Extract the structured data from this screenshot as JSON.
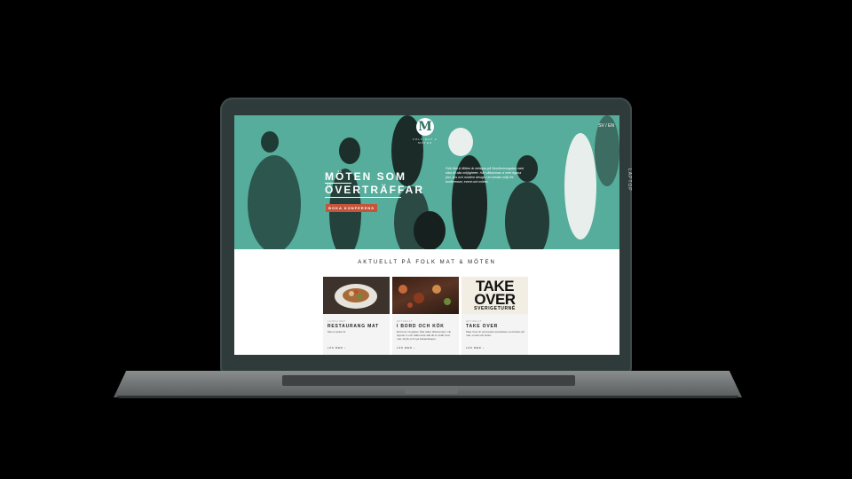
{
  "device": {
    "side_label": "LAPTOP"
  },
  "site": {
    "logo_letter": "M",
    "logo_text": "FOLK MAT & MÖTEN",
    "lang": "SV / EN",
    "hero": {
      "headline_1": "MÖTEN SOM",
      "headline_2": "ÖVERTRÄFFAR",
      "cta": "BOKA KONFERENS",
      "intro": "Folk Mat & Möten är belägna på Stockholmsgatan med nära till alla möjligheter. Här välkomnas vi med öppna ytor, ljus och modern design i en kreativ miljö för konferenser, event och möten."
    },
    "section_title": "AKTUELLT PÅ FOLK MAT & MÖTEN",
    "cards": [
      {
        "kicker": "LUNCH MAT",
        "title": "RESTAURANG MAT",
        "desc": "Menu vecka 14",
        "more": "LÄS MER ›"
      },
      {
        "kicker": "AKTUELLT",
        "title": "I BORD OCH KÖK",
        "desc": "Ett bord, 14 gäster, åtta rätter tillsammans. Nu öppnar vi och välkomnar alla till en kväll med mat, dryck och nya bekantskaper.",
        "more": "LÄS MER ›"
      },
      {
        "kicker": "AKTUELLT",
        "title": "TAKE OVER",
        "desc": "Take Over är ett kreativt samarbete med fokus på mat, musik och kultur.",
        "more": "LÄS MER ›",
        "image_text_1": "TAKE",
        "image_text_2": "OVER",
        "image_text_3": "SVERIGETURNÉ"
      }
    ]
  },
  "colors": {
    "hero_teal": "#4fa996",
    "cta": "#c4553a",
    "lid": "#2f3a3a"
  }
}
